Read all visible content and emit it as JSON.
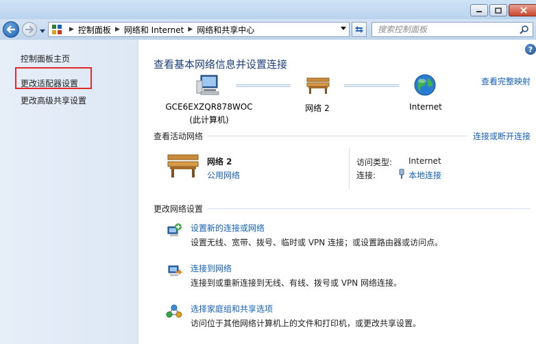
{
  "address": {
    "breadcrumbs": [
      "控制面板",
      "网络和 Internet",
      "网络和共享中心"
    ]
  },
  "search": {
    "placeholder": "搜索控制面板"
  },
  "sidebar": {
    "items": [
      {
        "label": "控制面板主页"
      },
      {
        "label": "更改适配器设置"
      },
      {
        "label": "更改高级共享设置"
      }
    ]
  },
  "main": {
    "title": "查看基本网络信息并设置连接",
    "view_full_map": "查看完整映射",
    "map": {
      "computer_name": "GCE6EXZQR878WOC",
      "computer_sub": "(此计算机)",
      "network_name": "网络  2",
      "internet_label": "Internet"
    },
    "active": {
      "section_label": "查看活动网络",
      "connect_link": "连接或断开连接",
      "network_name": "网络  2",
      "network_type": "公用网络",
      "access_type_label": "访问类型:",
      "access_type_value": "Internet",
      "connections_label": "连接:",
      "connections_value": "本地连接"
    },
    "change": {
      "section_label": "更改网络设置",
      "tasks": [
        {
          "link": "设置新的连接或网络",
          "desc": "设置无线、宽带、拨号、临时或 VPN 连接；或设置路由器或访问点。"
        },
        {
          "link": "连接到网络",
          "desc": "连接到或重新连接到无线、有线、拨号或 VPN 网络连接。"
        },
        {
          "link": "选择家庭组和共享选项",
          "desc": "访问位于其他网络计算机上的文件和打印机，或更改共享设置。"
        }
      ]
    }
  },
  "colors": {
    "link": "#1560b8",
    "title": "#1d3f7c",
    "highlight": "#e02a2a"
  }
}
